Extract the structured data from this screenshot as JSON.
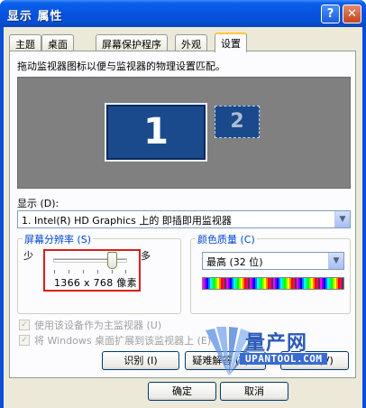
{
  "window": {
    "title": "显示 属性",
    "help_label": "?",
    "close_label": "✕"
  },
  "tabs": [
    {
      "label": "主题",
      "active": false
    },
    {
      "label": "桌面",
      "active": false
    },
    {
      "label": "屏幕保护程序",
      "active": false
    },
    {
      "label": "外观",
      "active": false
    },
    {
      "label": "设置",
      "active": true
    }
  ],
  "settings": {
    "instruction": "拖动监视器图标以便与监视器的物理设置匹配。",
    "monitor1_number": "1",
    "monitor2_number": "2",
    "display_label": "显示 (D):",
    "display_value": "1. Intel(R) HD Graphics 上的 即插即用监视器",
    "resolution": {
      "group_label": "屏幕分辨率 (S)",
      "less_label": "少",
      "more_label": "多",
      "value_text": "1366 x 768 像素",
      "slider_position": 0.8
    },
    "color_quality": {
      "group_label": "颜色质量 (C)",
      "value": "最高 (32 位)"
    },
    "primary_checkbox": {
      "label": "使用该设备作为主监视器 (U)",
      "checked": true,
      "disabled": true
    },
    "extend_checkbox": {
      "label": "将 Windows 桌面扩展到该监视器上 (E)",
      "checked": true,
      "disabled": true
    },
    "buttons": {
      "identify": "识别 (I)",
      "troubleshoot": "疑难解答 (T)...",
      "advanced": "高级 (V)"
    }
  },
  "footer": {
    "ok": "确定",
    "cancel": "取消"
  },
  "watermark": {
    "text_cn": "量产网",
    "text_en": "UPANTOOL.COM"
  },
  "colors": {
    "title_blue": "#0553e0",
    "tab_active_accent": "#ffc83c",
    "group_label_blue": "#0046d5",
    "highlight_red": "#d8201a",
    "monitor_blue": "#1a4a8c"
  }
}
